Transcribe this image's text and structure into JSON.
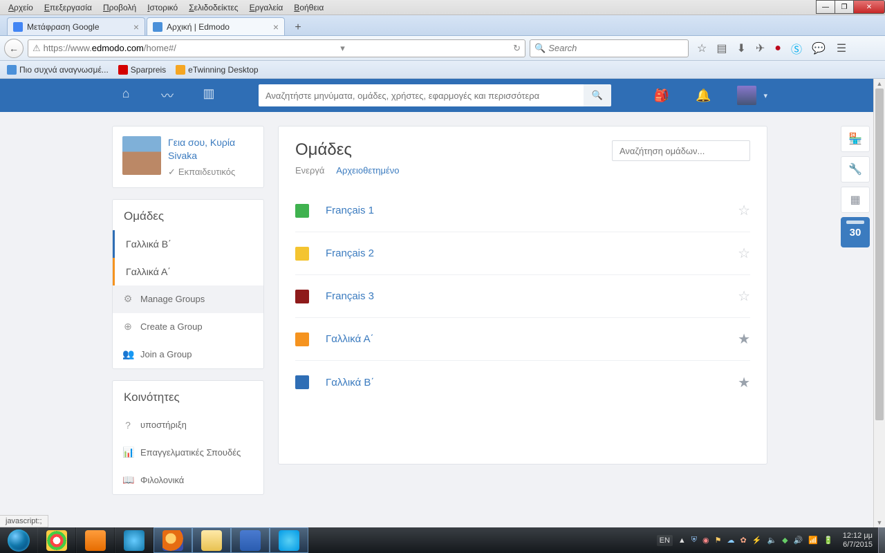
{
  "firefox": {
    "menu": [
      "Αρχείο",
      "Επεξεργασία",
      "Προβολή",
      "Ιστορικό",
      "Σελιδοδείκτες",
      "Εργαλεία",
      "Βοήθεια"
    ],
    "tabs": [
      {
        "title": "Μετάφραση Google",
        "active": false
      },
      {
        "title": "Αρχική | Edmodo",
        "active": true
      }
    ],
    "url_prefix": "https://www.",
    "url_domain": "edmodo.com",
    "url_path": "/home#/",
    "search_placeholder": "Search",
    "bookmarks": [
      {
        "label": "Πιο συχνά αναγνωσμέ...",
        "color": "#4a90d9"
      },
      {
        "label": "Sparpreis",
        "color": "#d40000"
      },
      {
        "label": "eTwinning Desktop",
        "color": "#f5a623"
      }
    ],
    "status": "javascript:;"
  },
  "edmodo": {
    "search_placeholder": "Αναζητήστε μηνύματα, ομάδες, χρήστες, εφαρμογές και περισσότερα",
    "profile": {
      "greeting": "Γεια σου, Κυρία Sivaka",
      "role": "Εκπαιδευτικός"
    },
    "sidebar": {
      "groups_header": "Ομάδες",
      "groups": [
        {
          "label": "Γαλλικά Β΄",
          "accent": "b"
        },
        {
          "label": "Γαλλικά Α΄",
          "accent": "o"
        }
      ],
      "manage_label": "Manage Groups",
      "create_label": "Create a Group",
      "join_label": "Join a Group",
      "communities_header": "Κοινότητες",
      "communities": [
        {
          "label": "υποστήριξη",
          "icon": "?"
        },
        {
          "label": "Επαγγελματικές Σπουδές",
          "icon": "chart"
        },
        {
          "label": "Φιλολονικά",
          "icon": "book"
        }
      ]
    },
    "main": {
      "title": "Ομάδες",
      "tab_active": "Ενεργά",
      "tab_archived": "Αρχειοθετημένο",
      "search_placeholder": "Αναζήτηση ομάδων...",
      "groups": [
        {
          "name": "Français 1",
          "color": "#3fb24f",
          "fav": false
        },
        {
          "name": "Français 2",
          "color": "#f4c430",
          "fav": false
        },
        {
          "name": "Français 3",
          "color": "#8e1b1b",
          "fav": false
        },
        {
          "name": "Γαλλικά Α΄",
          "color": "#f5931f",
          "fav": true
        },
        {
          "name": "Γαλλικά Β΄",
          "color": "#2f6eb5",
          "fav": true
        }
      ]
    },
    "rail_calendar": "30"
  },
  "taskbar": {
    "apps": [
      {
        "name": "chrome",
        "bg": "radial-gradient(circle,#fff 25%,#f44 0 45%,#4c4 0 65%,#fc4 0)"
      },
      {
        "name": "media",
        "bg": "linear-gradient(#ff9d3c,#e66c00)"
      },
      {
        "name": "ie",
        "bg": "radial-gradient(circle,#6cf,#17a)"
      },
      {
        "name": "firefox",
        "bg": "radial-gradient(circle at 40% 40%,#ffcf6b 0 30%,#e66c12 30% 70%,#3b4fa8 70%)",
        "active": true
      },
      {
        "name": "explorer",
        "bg": "linear-gradient(#ffe9a8,#e8c251)",
        "active": true
      },
      {
        "name": "word",
        "bg": "linear-gradient(#4a7bd0,#2a5db0)",
        "active": true
      },
      {
        "name": "skype",
        "bg": "radial-gradient(circle,#5ad0f4,#0099e5)",
        "active": true
      }
    ],
    "lang": "EN",
    "time": "12:12 μμ",
    "date": "6/7/2015"
  }
}
